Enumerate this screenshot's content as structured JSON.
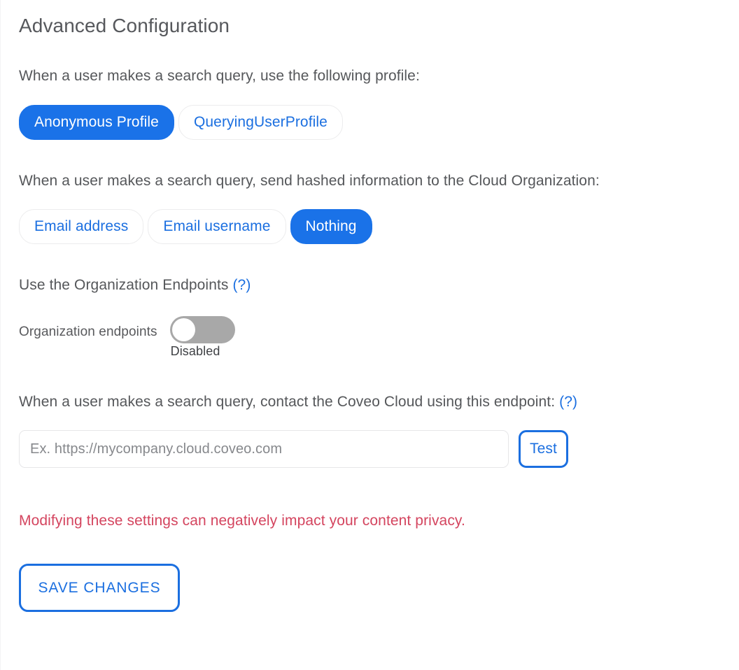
{
  "page": {
    "title": "Advanced Configuration"
  },
  "profile_section": {
    "prompt": "When a user makes a search query, use the following profile:",
    "options": [
      {
        "label": "Anonymous Profile",
        "selected": true
      },
      {
        "label": "QueryingUserProfile",
        "selected": false
      }
    ]
  },
  "hashed_info_section": {
    "prompt": "When a user makes a search query, send hashed information to the Cloud Organization:",
    "options": [
      {
        "label": "Email address",
        "selected": false
      },
      {
        "label": "Email username",
        "selected": false
      },
      {
        "label": "Nothing",
        "selected": true
      }
    ]
  },
  "org_endpoints_section": {
    "heading": "Use the Organization Endpoints",
    "help_label": "(?)",
    "toggle_label": "Organization endpoints",
    "toggle_state": "Disabled",
    "toggle_on": false
  },
  "endpoint_section": {
    "prompt": "When a user makes a search query, contact the Coveo Cloud using this endpoint:",
    "help_label": "(?)",
    "input_value": "",
    "input_placeholder": "Ex. https://mycompany.cloud.coveo.com",
    "test_label": "Test"
  },
  "warning": {
    "text": "Modifying these settings can negatively impact your content privacy."
  },
  "actions": {
    "save_label": "SAVE CHANGES"
  },
  "colors": {
    "accent_blue": "#1a72e8",
    "link_blue": "#1b6fe0",
    "warning_red": "#d4455f",
    "toggle_off_gray": "#a8a8a8",
    "text_gray": "#55575a"
  }
}
